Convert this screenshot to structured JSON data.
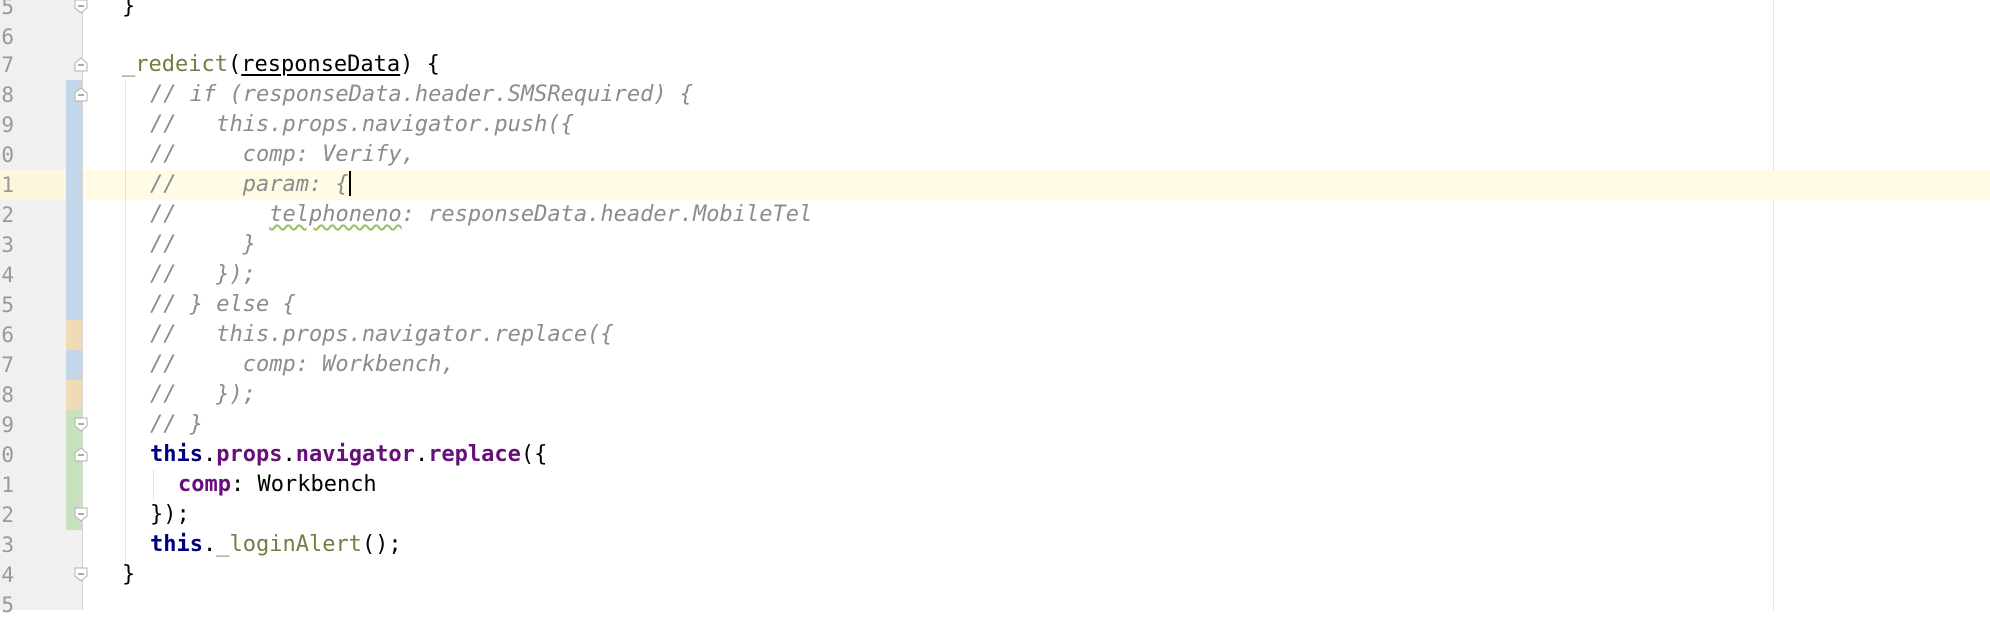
{
  "editor": {
    "line_numbers": [
      "5",
      "6",
      "7",
      "8",
      "9",
      "0",
      "1",
      "2",
      "3",
      "4",
      "5",
      "6",
      "7",
      "8",
      "9",
      "0",
      "1",
      "2",
      "3",
      "4",
      "5"
    ],
    "code": {
      "l0_brace": "}",
      "l2_fn": "_redeict",
      "l2_paren_open": "(",
      "l2_param": "responseData",
      "l2_paren_close": ") {",
      "l3_comment": "// if (responseData.header.SMSRequired) {",
      "l4_comment": "//   this.props.navigator.push({",
      "l5_comment": "//     comp: Verify,",
      "l6_comment": "//     param: {",
      "l7_comment_a": "//       ",
      "l7_comment_b": "telphoneno",
      "l7_comment_c": ": responseData.header.MobileTel",
      "l8_comment": "//     }",
      "l9_comment": "//   });",
      "l10_comment": "// } else {",
      "l11_comment": "//   this.props.navigator.replace({",
      "l12_comment": "//     comp: Workbench,",
      "l13_comment": "//   });",
      "l14_comment": "// }",
      "l15_this": "this",
      "l15_dot1": ".",
      "l15_props": "props",
      "l15_dot2": ".",
      "l15_navigator": "navigator",
      "l15_dot3": ".",
      "l15_replace": "replace",
      "l15_end": "({",
      "l16_comp": "comp",
      "l16_rest": ": Workbench",
      "l17_close": "});",
      "l18_this": "this",
      "l18_dot": ".",
      "l18_fn": "_loginAlert",
      "l18_end": "();",
      "l19_brace": "}"
    },
    "colors": {
      "gutter": "#f0f0f0",
      "current_line": "#fffbe4",
      "comment": "#8c8c8c",
      "keyword": "#000080",
      "property": "#660e7a",
      "function": "#7a7a43",
      "change_modified": "#c4d6ea",
      "change_added": "#c8e2bf",
      "change_tan": "#efdcb5"
    }
  }
}
